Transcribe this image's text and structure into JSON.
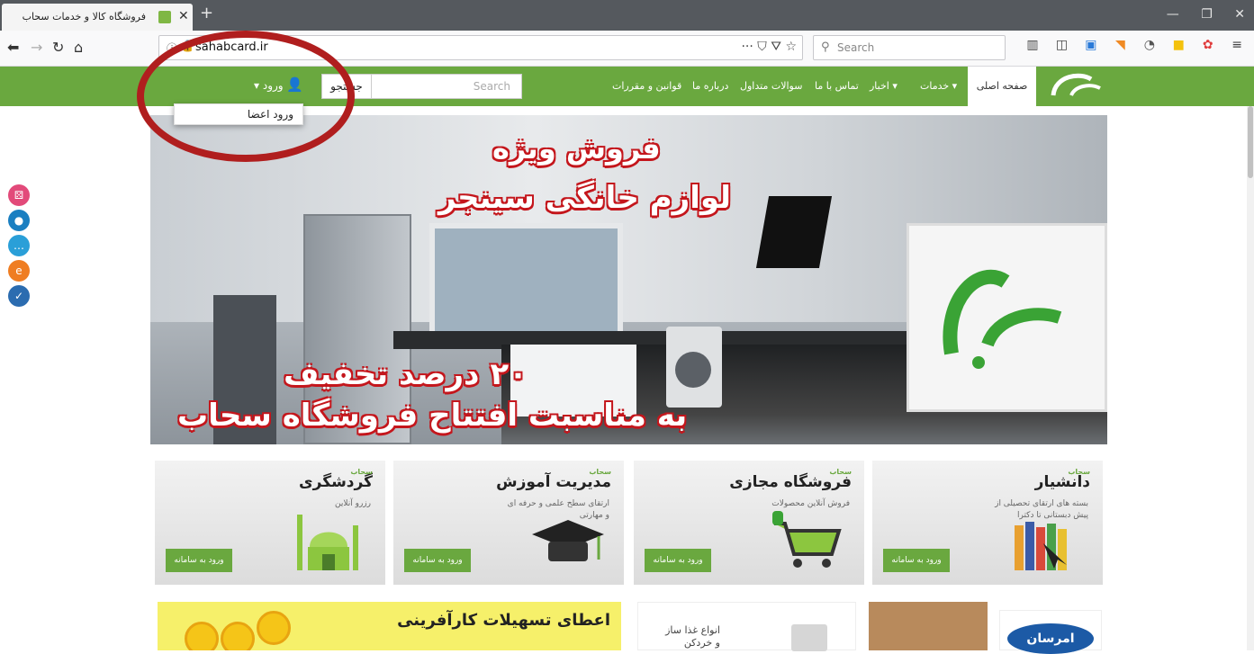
{
  "browser": {
    "tab_title": "فروشگاه کالا و خدمات سحاب",
    "tab_close": "✕",
    "new_tab": "+",
    "url": "sahabcard.ir",
    "url_actions": "··· ⛉ ⛛ ☆",
    "search_placeholder": "Search",
    "window_controls": [
      "—",
      "❐",
      "✕"
    ],
    "nav_icons": [
      "back-icon",
      "forward-icon",
      "reload-icon",
      "home-icon"
    ],
    "toolbar_icons": [
      "library-icon",
      "sidebar-icon",
      "screenshot-icon",
      "rss-icon",
      "clock-icon",
      "note-icon",
      "extension-icon",
      "menu-icon"
    ]
  },
  "header": {
    "home_label": "صفحه اصلی",
    "menu": [
      "خدمات ▾",
      "اخبار ▾",
      "تماس با ما",
      "سوالات متداول",
      "درباره ما",
      "قوانین و مقررات"
    ],
    "search_placeholder": "Search",
    "search_button": "جستجو",
    "login_label": "▾ ورود",
    "login_dropdown_item": "ورود اعضا"
  },
  "social_icons": [
    "dice-icon",
    "drop-icon",
    "chat-icon",
    "ie-icon",
    "check-icon"
  ],
  "hero": {
    "line1": "فروش ویژه",
    "line2": "لوازم خانگی سینجر",
    "line3": "۲۰ درصد تخفیف",
    "line4": "به مناسبت افتتاح فروشگاه سحاب"
  },
  "cards": [
    {
      "title": "دانشیار",
      "sup": "سحاب",
      "desc": "بسته های ارتقای تحصیلی از پیش دبستانی تا دکترا",
      "button": "ورود به سامانه",
      "icon": "books-icon"
    },
    {
      "title": "فروشگاه مجازی",
      "sup": "سحاب",
      "desc": "فروش آنلاین محصولات",
      "button": "ورود به سامانه",
      "icon": "cart-icon"
    },
    {
      "title": "مدیریت آموزش",
      "sup": "سحاب",
      "desc": "ارتقای سطح علمی و حرفه ای و مهارتی",
      "button": "ورود به سامانه",
      "icon": "graduation-cap-icon"
    },
    {
      "title": "گردشگری",
      "sup": "سحاب",
      "desc": "رزرو آنلاین",
      "button": "ورود به سامانه",
      "icon": "mosque-icon"
    }
  ],
  "bottom": {
    "promo_text": "اعطای تسهیلات کارآفرینی",
    "food_line1": "انواع غذا ساز",
    "food_line2": "و خردکن",
    "brand": "امرسان"
  },
  "colors": {
    "header_green": "#6aa83f",
    "oval_red": "#b01e1e",
    "hero_text_stroke": "#c4161c"
  }
}
